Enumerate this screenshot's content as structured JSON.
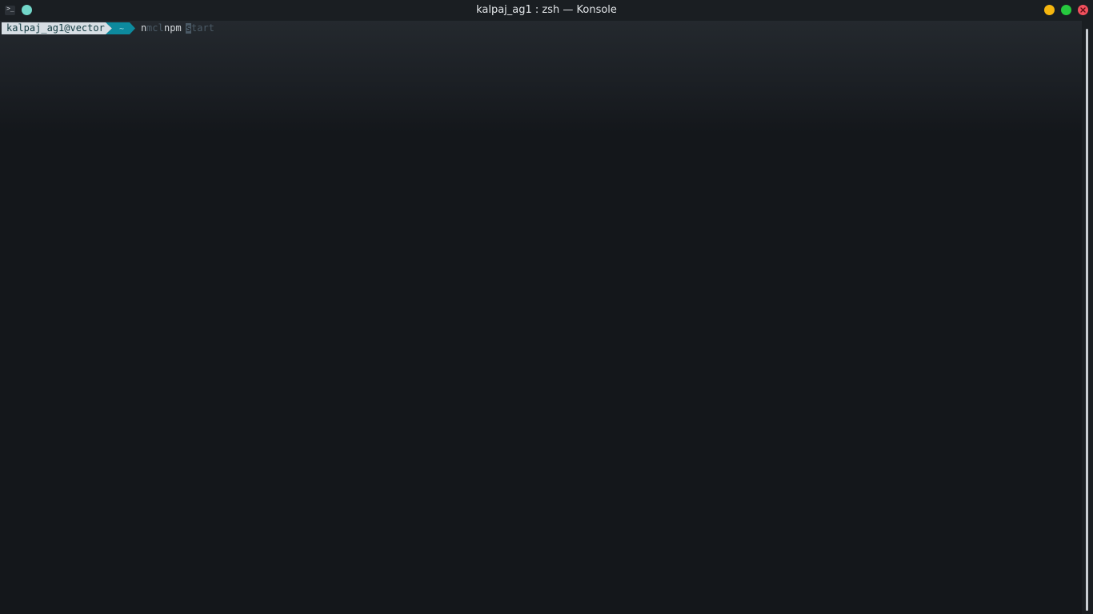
{
  "window": {
    "title": "kalpaj_ag1 : zsh — Konsole",
    "app_icon_glyph": ">_",
    "icons": {
      "app": "terminal-icon",
      "pin": "pin-dot-icon",
      "minimize": "minimize-icon",
      "maximize": "maximize-icon",
      "close": "close-icon"
    },
    "colors": {
      "pin": "#72d6c9",
      "minimize": "#f5b60f",
      "maximize": "#26c93e",
      "close": "#f2505d"
    }
  },
  "terminal": {
    "prompt": {
      "user_host": "kalpaj_ag1@vector",
      "dir": "~",
      "user_bg": "#d7dee4",
      "dir_bg": "#0d8a9e"
    },
    "command": {
      "typed_prefix": "n",
      "suggestion_mid": "mcl",
      "typed_main": "npm ",
      "cursor_char": "s",
      "suggestion_tail": "tart"
    }
  }
}
